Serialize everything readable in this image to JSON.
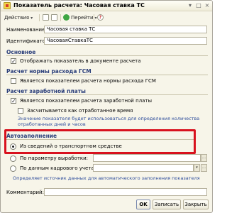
{
  "window": {
    "title": "Показатель расчета: Часовая ставка ТС",
    "controls": {
      "menu": "▾",
      "maximize": "□",
      "close": "×"
    }
  },
  "toolbar": {
    "actions": "Действия",
    "goto": "Перейти",
    "help": "?",
    "dropdown": "▾"
  },
  "fields": {
    "name_label": "Наименование:",
    "name_value": "Часовая ставка ТС",
    "id_label": "Идентификатор:",
    "id_value": "ЧасоваяСтавкаТС"
  },
  "sections": {
    "main": {
      "title": "Основное",
      "show_in_doc_label": "Отображать показатель в документе расчета",
      "show_in_doc_checked": true
    },
    "fuel": {
      "title": "Расчет нормы расхода ГСМ",
      "is_fuel_label": "Является показателем расчета нормы расхода ГСМ",
      "is_fuel_checked": false
    },
    "salary": {
      "title": "Расчет заработной платы",
      "is_salary_label": "Является показателем расчета заработной платы",
      "is_salary_checked": true,
      "worked_time_label": "Засчитывается как отработанное время",
      "worked_time_checked": false,
      "hint_line1": "Значение показателя будет использоваться для определения количества",
      "hint_line2": "отработанных дней и часов"
    },
    "autofill": {
      "title": "Автозаполнение",
      "option_vehicle": "Из сведений о транспортном средстве",
      "option_vehicle_selected": true,
      "option_param": "По параметру выработки:",
      "option_hr": "По данным кадрового учета:",
      "hint": "Определяет источник данных для автоматического заполнения показателя"
    }
  },
  "comment": {
    "label": "Комментарий:",
    "value": ""
  },
  "footer": {
    "ok": "OK",
    "save": "Записать",
    "close": "Закрыть"
  },
  "colors": {
    "highlight": "#d8111e",
    "section_title": "#2b3f7a",
    "hint": "#2e4d9c"
  }
}
